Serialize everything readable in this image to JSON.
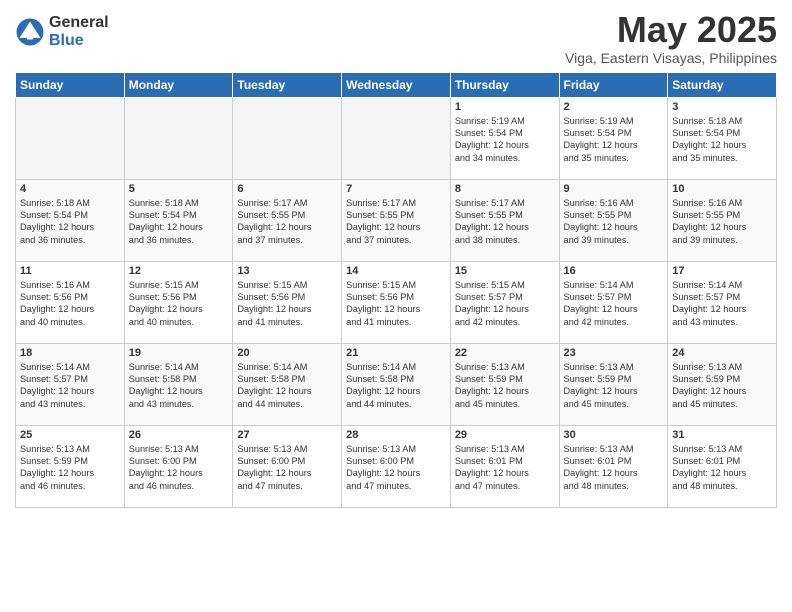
{
  "logo": {
    "general": "General",
    "blue": "Blue"
  },
  "title": "May 2025",
  "location": "Viga, Eastern Visayas, Philippines",
  "days_of_week": [
    "Sunday",
    "Monday",
    "Tuesday",
    "Wednesday",
    "Thursday",
    "Friday",
    "Saturday"
  ],
  "weeks": [
    [
      {
        "day": "",
        "info": ""
      },
      {
        "day": "",
        "info": ""
      },
      {
        "day": "",
        "info": ""
      },
      {
        "day": "",
        "info": ""
      },
      {
        "day": "1",
        "info": "Sunrise: 5:19 AM\nSunset: 5:54 PM\nDaylight: 12 hours\nand 34 minutes."
      },
      {
        "day": "2",
        "info": "Sunrise: 5:19 AM\nSunset: 5:54 PM\nDaylight: 12 hours\nand 35 minutes."
      },
      {
        "day": "3",
        "info": "Sunrise: 5:18 AM\nSunset: 5:54 PM\nDaylight: 12 hours\nand 35 minutes."
      }
    ],
    [
      {
        "day": "4",
        "info": "Sunrise: 5:18 AM\nSunset: 5:54 PM\nDaylight: 12 hours\nand 36 minutes."
      },
      {
        "day": "5",
        "info": "Sunrise: 5:18 AM\nSunset: 5:54 PM\nDaylight: 12 hours\nand 36 minutes."
      },
      {
        "day": "6",
        "info": "Sunrise: 5:17 AM\nSunset: 5:55 PM\nDaylight: 12 hours\nand 37 minutes."
      },
      {
        "day": "7",
        "info": "Sunrise: 5:17 AM\nSunset: 5:55 PM\nDaylight: 12 hours\nand 37 minutes."
      },
      {
        "day": "8",
        "info": "Sunrise: 5:17 AM\nSunset: 5:55 PM\nDaylight: 12 hours\nand 38 minutes."
      },
      {
        "day": "9",
        "info": "Sunrise: 5:16 AM\nSunset: 5:55 PM\nDaylight: 12 hours\nand 39 minutes."
      },
      {
        "day": "10",
        "info": "Sunrise: 5:16 AM\nSunset: 5:55 PM\nDaylight: 12 hours\nand 39 minutes."
      }
    ],
    [
      {
        "day": "11",
        "info": "Sunrise: 5:16 AM\nSunset: 5:56 PM\nDaylight: 12 hours\nand 40 minutes."
      },
      {
        "day": "12",
        "info": "Sunrise: 5:15 AM\nSunset: 5:56 PM\nDaylight: 12 hours\nand 40 minutes."
      },
      {
        "day": "13",
        "info": "Sunrise: 5:15 AM\nSunset: 5:56 PM\nDaylight: 12 hours\nand 41 minutes."
      },
      {
        "day": "14",
        "info": "Sunrise: 5:15 AM\nSunset: 5:56 PM\nDaylight: 12 hours\nand 41 minutes."
      },
      {
        "day": "15",
        "info": "Sunrise: 5:15 AM\nSunset: 5:57 PM\nDaylight: 12 hours\nand 42 minutes."
      },
      {
        "day": "16",
        "info": "Sunrise: 5:14 AM\nSunset: 5:57 PM\nDaylight: 12 hours\nand 42 minutes."
      },
      {
        "day": "17",
        "info": "Sunrise: 5:14 AM\nSunset: 5:57 PM\nDaylight: 12 hours\nand 43 minutes."
      }
    ],
    [
      {
        "day": "18",
        "info": "Sunrise: 5:14 AM\nSunset: 5:57 PM\nDaylight: 12 hours\nand 43 minutes."
      },
      {
        "day": "19",
        "info": "Sunrise: 5:14 AM\nSunset: 5:58 PM\nDaylight: 12 hours\nand 43 minutes."
      },
      {
        "day": "20",
        "info": "Sunrise: 5:14 AM\nSunset: 5:58 PM\nDaylight: 12 hours\nand 44 minutes."
      },
      {
        "day": "21",
        "info": "Sunrise: 5:14 AM\nSunset: 5:58 PM\nDaylight: 12 hours\nand 44 minutes."
      },
      {
        "day": "22",
        "info": "Sunrise: 5:13 AM\nSunset: 5:59 PM\nDaylight: 12 hours\nand 45 minutes."
      },
      {
        "day": "23",
        "info": "Sunrise: 5:13 AM\nSunset: 5:59 PM\nDaylight: 12 hours\nand 45 minutes."
      },
      {
        "day": "24",
        "info": "Sunrise: 5:13 AM\nSunset: 5:59 PM\nDaylight: 12 hours\nand 45 minutes."
      }
    ],
    [
      {
        "day": "25",
        "info": "Sunrise: 5:13 AM\nSunset: 5:59 PM\nDaylight: 12 hours\nand 46 minutes."
      },
      {
        "day": "26",
        "info": "Sunrise: 5:13 AM\nSunset: 6:00 PM\nDaylight: 12 hours\nand 46 minutes."
      },
      {
        "day": "27",
        "info": "Sunrise: 5:13 AM\nSunset: 6:00 PM\nDaylight: 12 hours\nand 47 minutes."
      },
      {
        "day": "28",
        "info": "Sunrise: 5:13 AM\nSunset: 6:00 PM\nDaylight: 12 hours\nand 47 minutes."
      },
      {
        "day": "29",
        "info": "Sunrise: 5:13 AM\nSunset: 6:01 PM\nDaylight: 12 hours\nand 47 minutes."
      },
      {
        "day": "30",
        "info": "Sunrise: 5:13 AM\nSunset: 6:01 PM\nDaylight: 12 hours\nand 48 minutes."
      },
      {
        "day": "31",
        "info": "Sunrise: 5:13 AM\nSunset: 6:01 PM\nDaylight: 12 hours\nand 48 minutes."
      }
    ]
  ]
}
